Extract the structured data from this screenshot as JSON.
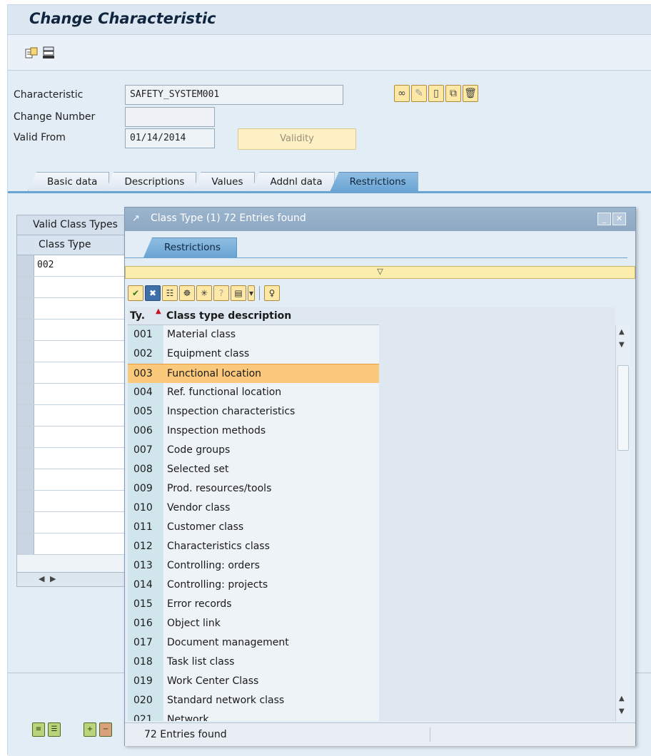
{
  "window": {
    "title": "Change Characteristic"
  },
  "header": {
    "fields": [
      {
        "label": "Characteristic",
        "value": "SAFETY_SYSTEM001"
      },
      {
        "label": "Change Number",
        "value": ""
      },
      {
        "label": "Valid From",
        "value": "01/14/2014"
      }
    ],
    "validity_button": "Validity"
  },
  "tabs": [
    "Basic data",
    "Descriptions",
    "Values",
    "Addnl data",
    "Restrictions"
  ],
  "active_tab": "Restrictions",
  "class_types_table": {
    "title": "Valid Class Types",
    "column": "Class Type",
    "rows": [
      "002"
    ]
  },
  "dialog": {
    "title": "Class Type (1)   72 Entries found",
    "tab": "Restrictions",
    "expander": "▽",
    "columns": {
      "code": "Ty.",
      "description": "Class type description"
    },
    "rows": [
      {
        "code": "001",
        "description": "Material class"
      },
      {
        "code": "002",
        "description": "Equipment class"
      },
      {
        "code": "003",
        "description": "Functional location"
      },
      {
        "code": "004",
        "description": "Ref. functional location"
      },
      {
        "code": "005",
        "description": "Inspection characteristics"
      },
      {
        "code": "006",
        "description": "Inspection methods"
      },
      {
        "code": "007",
        "description": "Code groups"
      },
      {
        "code": "008",
        "description": "Selected set"
      },
      {
        "code": "009",
        "description": "Prod. resources/tools"
      },
      {
        "code": "010",
        "description": "Vendor class"
      },
      {
        "code": "011",
        "description": "Customer class"
      },
      {
        "code": "012",
        "description": "Characteristics class"
      },
      {
        "code": "013",
        "description": "Controlling: orders"
      },
      {
        "code": "014",
        "description": "Controlling: projects"
      },
      {
        "code": "015",
        "description": "Error records"
      },
      {
        "code": "016",
        "description": "Object link"
      },
      {
        "code": "017",
        "description": "Document management"
      },
      {
        "code": "018",
        "description": "Task list class"
      },
      {
        "code": "019",
        "description": "Work Center Class"
      },
      {
        "code": "020",
        "description": "Standard network class"
      },
      {
        "code": "021",
        "description": "Network"
      }
    ],
    "selected_code": "003",
    "status": "72 Entries found"
  },
  "icons": {
    "toolbar": [
      "other-object-icon",
      "display-change-icon"
    ],
    "header_tools": [
      "where-used-icon",
      "change-icon",
      "create-icon",
      "copy-icon",
      "delete-icon"
    ],
    "dialog_tools": [
      "check-icon",
      "cancel-icon",
      "find-icon",
      "find-next-icon",
      "filter-icon",
      "help-icon",
      "print-icon",
      "clean-icon"
    ]
  },
  "colors": {
    "tab_active": "#6aa4d3",
    "highlight_row": "#fbc97b",
    "expander": "#fbedac"
  }
}
